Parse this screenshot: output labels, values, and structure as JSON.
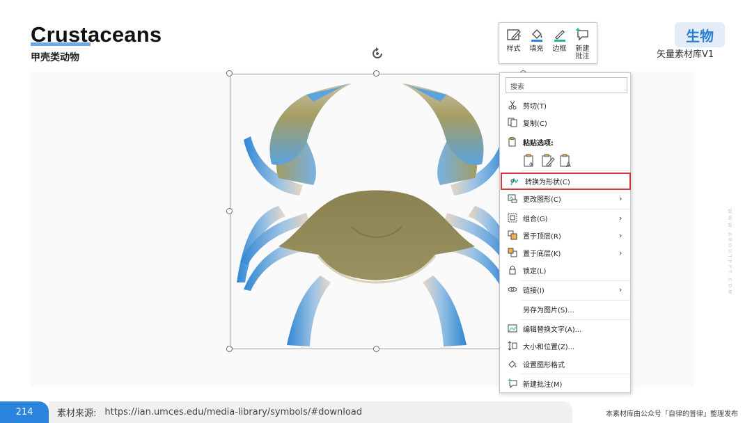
{
  "header": {
    "title": "Crustaceans",
    "subtitle": "甲壳类动物",
    "category": "生物",
    "library_name": "矢量素材库V1",
    "watermark": "WWW.ABOUTPPT.COM"
  },
  "mini_toolbar": {
    "tools": [
      {
        "label": "样式",
        "icon": "style-pen-icon"
      },
      {
        "label": "填充",
        "icon": "fill-bucket-icon"
      },
      {
        "label": "边框",
        "icon": "border-pen-icon"
      },
      {
        "label": "新建\n批注",
        "icon": "new-comment-icon"
      }
    ]
  },
  "context_menu": {
    "search_placeholder": "搜索",
    "cut": "剪切(T)",
    "copy": "复制(C)",
    "paste_options": "粘贴选项:",
    "convert_to_shape": "转换为形状(C)",
    "change_graphic": "更改图形(C)",
    "group": "组合(G)",
    "bring_to_front": "置于顶层(R)",
    "send_to_back": "置于底层(K)",
    "lock": "锁定(L)",
    "link": "链接(I)",
    "save_as_picture": "另存为图片(S)...",
    "edit_alt_text": "编辑替换文字(A)...",
    "size_and_position": "大小和位置(Z)...",
    "format_graphic": "设置图形格式",
    "new_comment": "新建批注(M)",
    "highlight_color": "#d9363e"
  },
  "footer": {
    "page_number": "214",
    "source_label": "素材来源:",
    "source_url": "https://ian.umces.edu/media-library/symbols/#download",
    "credit": "本素材库由公众号「自律的普律」整理发布"
  },
  "colors": {
    "accent": "#2b85dd",
    "crab_body": "#8d8550",
    "crab_leg_blue": "#3b8fd6"
  }
}
